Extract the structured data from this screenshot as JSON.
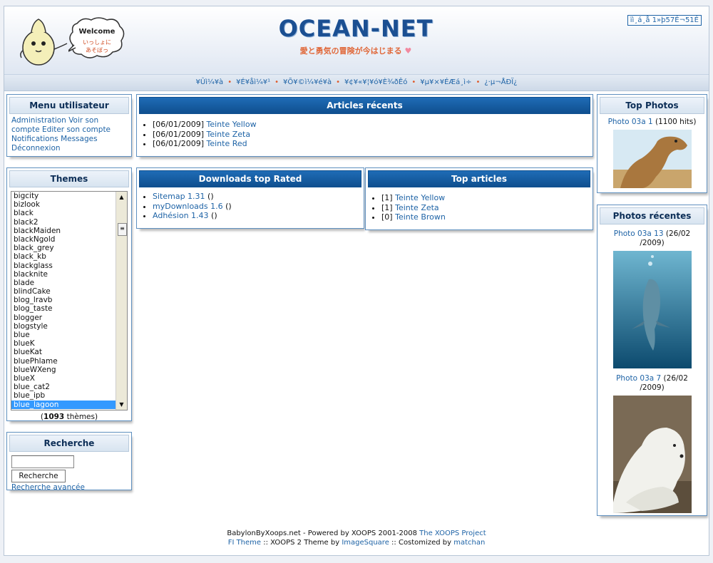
{
  "header": {
    "bubble_welcome": "Welcome",
    "bubble_jp": "いっしょに\nあそぼっ",
    "logo": "OCEAN-NET",
    "tagline": "愛と勇気の冒険が今はじまる",
    "top_right": "ïì¸á¸å 1»þ57É¬51É"
  },
  "nav": {
    "items": [
      "¥Ûì¼¥à",
      "¥É¥åì¼¥¹",
      "¥Õ¥©ì¼¥é¥à",
      "¥¢¥«¥¦¥ó¥È¾ðÊó",
      "¥µ¥×¥ÉÆá¸ì÷",
      "¿·µ¬ÅÐÏ¿"
    ],
    "separator": "•"
  },
  "user_menu": {
    "title": "Menu utilisateur",
    "links": [
      "Administration",
      "Voir son compte",
      "Editer son compte",
      "Notifications",
      "Messages",
      "Déconnexion"
    ]
  },
  "themes": {
    "title": "Themes",
    "items": [
      "bigcity",
      "bizlook",
      "black",
      "black2",
      "blackMaiden",
      "blackNgold",
      "black_grey",
      "black_kb",
      "blackglass",
      "blacknite",
      "blade",
      "blindCake",
      "blog_lravb",
      "blog_taste",
      "blogger",
      "blogstyle",
      "blue",
      "blueK",
      "blueKat",
      "bluePhlame",
      "blueWXeng",
      "blueX",
      "blue_cat2",
      "blue_ipb",
      "blue_lagoon"
    ],
    "selected": "blue_lagoon",
    "count": "1093",
    "count_suffix": " thèmes)",
    "count_prefix": "("
  },
  "search": {
    "title": "Recherche",
    "button": "Recherche",
    "advanced": "Recherche avancée",
    "value": ""
  },
  "recent_articles": {
    "title": "Articles récents",
    "items": [
      {
        "date": "[06/01/2009]",
        "title": "Teinte Yellow"
      },
      {
        "date": "[06/01/2009]",
        "title": "Teinte Zeta"
      },
      {
        "date": "[06/01/2009]",
        "title": "Teinte Red"
      }
    ]
  },
  "downloads": {
    "title": "Downloads top Rated",
    "items": [
      {
        "name": "Sitemap 1.31",
        "suffix": " ()"
      },
      {
        "name": "myDownloads 1.6",
        "suffix": " ()"
      },
      {
        "name": "Adhésion 1.43",
        "suffix": " ()"
      }
    ]
  },
  "top_articles": {
    "title": "Top articles",
    "items": [
      {
        "count": "[1]",
        "title": "Teinte Yellow"
      },
      {
        "count": "[1]",
        "title": "Teinte Zeta"
      },
      {
        "count": "[0]",
        "title": "Teinte Brown"
      }
    ]
  },
  "top_photos": {
    "title": "Top Photos",
    "photo_link": "Photo 03a 1",
    "photo_hits": " (1100 hits)"
  },
  "recent_photos": {
    "title": "Photos récentes",
    "items": [
      {
        "link": "Photo 03a 13",
        "date1": " (26/02",
        "date2": "/2009)"
      },
      {
        "link": "Photo 03a 7",
        "date1": " (26/02",
        "date2": "/2009)"
      }
    ]
  },
  "footer": {
    "line1_text": "BabylonByXoops.net - Powered by XOOPS 2001-2008 ",
    "line1_link": "The XOOPS Project",
    "line2_link1": "FI Theme",
    "line2_text1": " :: XOOPS 2 Theme by ",
    "line2_link2": "ImageSquare",
    "line2_text2": " :: Costomized by ",
    "line2_link3": "matchan"
  },
  "colors": {
    "link": "#1e63a6",
    "block_border": "#5e8fbf",
    "title_dark": "#1a62ac",
    "nav_separator": "#e05a2a",
    "selected_theme": "#3399ff"
  }
}
